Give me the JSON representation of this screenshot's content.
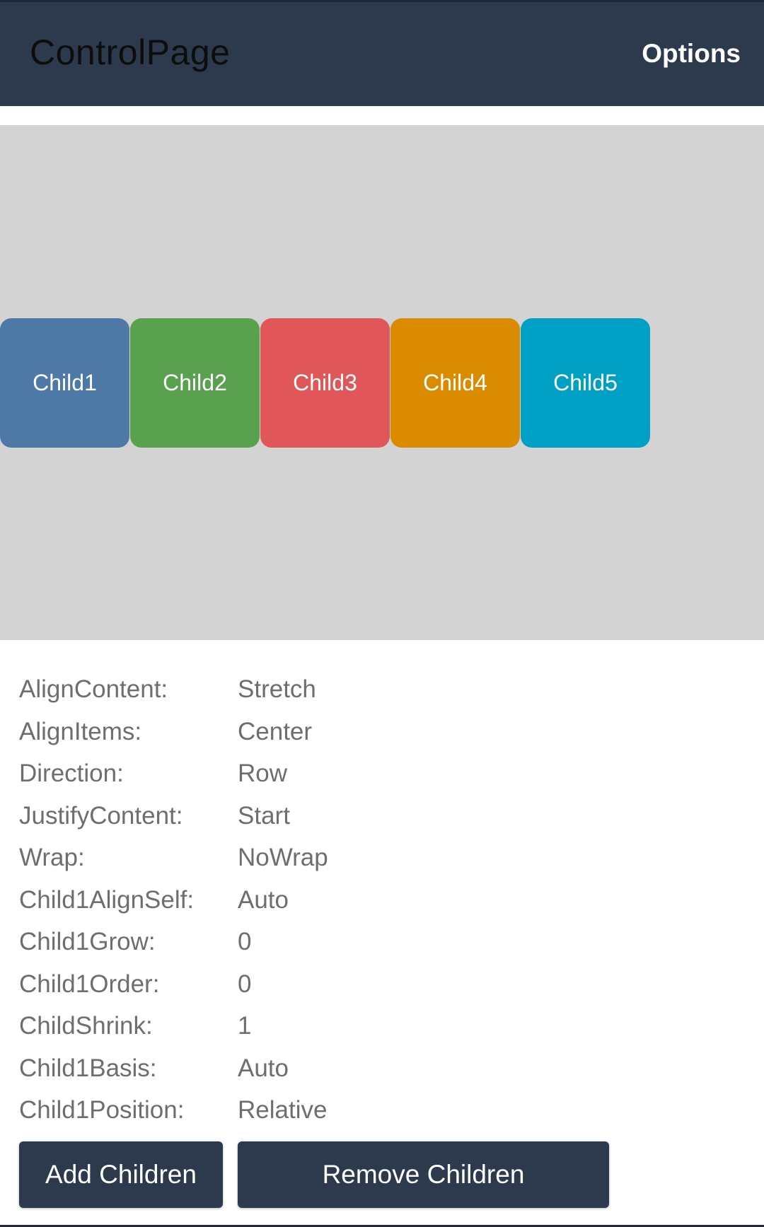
{
  "header": {
    "title": "ControlPage",
    "options_label": "Options"
  },
  "flex_children": [
    {
      "label": "Child1",
      "color": "#4e79a7"
    },
    {
      "label": "Child2",
      "color": "#59a14f"
    },
    {
      "label": "Child3",
      "color": "#e15759"
    },
    {
      "label": "Child4",
      "color": "#db8b00"
    },
    {
      "label": "Child5",
      "color": "#00a0c4"
    }
  ],
  "colors": {
    "header_bg": "#2d3a4d",
    "flex_area_bg": "#d3d3d3",
    "property_text": "#6e6e6e",
    "button_bg": "#2d3a4d"
  },
  "properties": [
    {
      "label": "AlignContent:",
      "value": "Stretch"
    },
    {
      "label": "AlignItems:",
      "value": "Center"
    },
    {
      "label": "Direction:",
      "value": "Row"
    },
    {
      "label": "JustifyContent:",
      "value": "Start"
    },
    {
      "label": "Wrap:",
      "value": "NoWrap"
    },
    {
      "label": "Child1AlignSelf:",
      "value": "Auto"
    },
    {
      "label": "Child1Grow:",
      "value": "0"
    },
    {
      "label": "Child1Order:",
      "value": "0"
    },
    {
      "label": "ChildShrink:",
      "value": "1"
    },
    {
      "label": "Child1Basis:",
      "value": "Auto"
    },
    {
      "label": "Child1Position:",
      "value": "Relative"
    }
  ],
  "buttons": {
    "add_label": "Add Children",
    "remove_label": "Remove Children"
  }
}
